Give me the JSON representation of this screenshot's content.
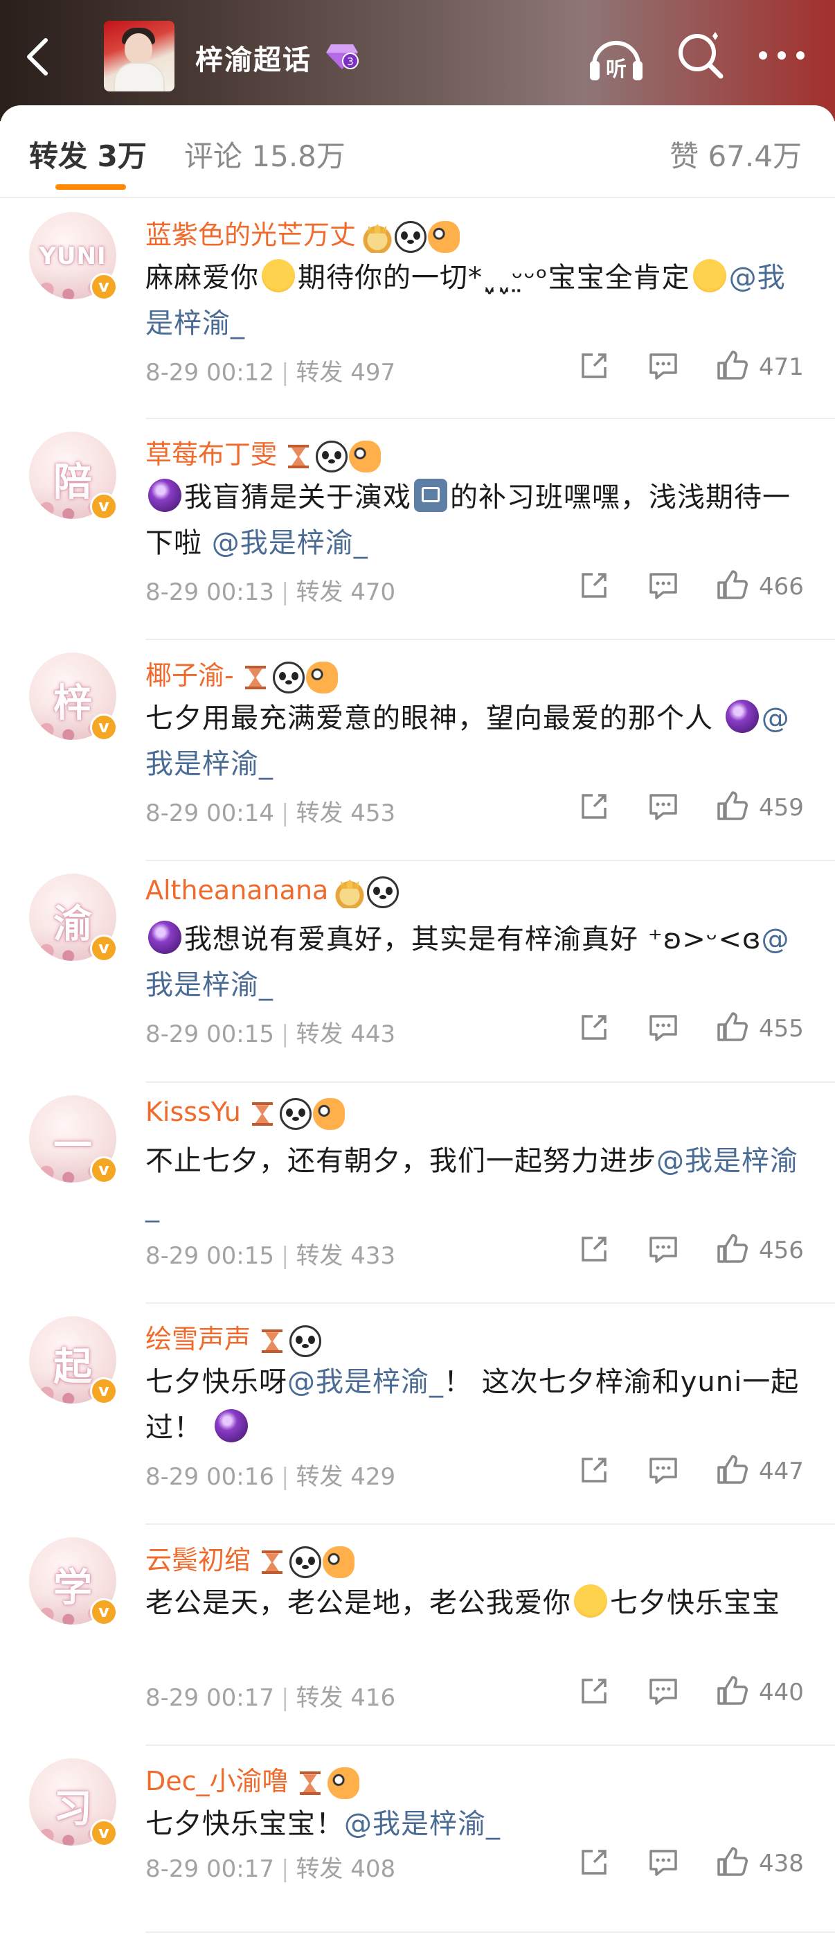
{
  "header": {
    "title": "梓渝超话",
    "icons": [
      "back-arrow-icon",
      "cover-photo",
      "diamond-level-icon",
      "listen-icon",
      "search-icon",
      "more-icon"
    ],
    "listen_label": "听",
    "gem_level": "3",
    "gradient_colors": [
      "#2a1f1b",
      "#6d5b57",
      "#a2302d"
    ]
  },
  "tabs": {
    "repost": {
      "label": "转发",
      "count": "3万"
    },
    "comment": {
      "label": "评论",
      "count": "15.8万"
    },
    "likes": {
      "label": "赞",
      "count": "67.4万"
    },
    "active": "repost",
    "accent": "#ff8a00"
  },
  "colors": {
    "username": "#f06a2b",
    "mention": "#4a6b94",
    "meta": "#a3a3a3"
  },
  "list": [
    {
      "avatar": "YUNI",
      "name": "蓝紫色的光芒万丈",
      "badges": [
        "crown",
        "panda",
        "fish"
      ],
      "content": [
        "麻麻爱你",
        {
          "emoji": "kiss"
        },
        "期待你的一切*ˬ̤ˬ̤ᵕ̤ᵕᵒ宝宝全肯定",
        {
          "emoji": "grin"
        },
        {
          "mention": "@我是梓渝_"
        }
      ],
      "time": "8-29 00:12",
      "repost_label": "转发",
      "repost_count": "497",
      "likes": "471"
    },
    {
      "avatar": "陪",
      "name": "草莓布丁雯",
      "badges": [
        "hourglass",
        "panda",
        "fish"
      ],
      "content": [
        {
          "emoji": "ball"
        },
        "我盲猜是关于演戏",
        {
          "emoji": "film"
        },
        "的补习班嘿嘿，浅浅期待一下啦 ",
        {
          "mention": "@我是梓渝_"
        }
      ],
      "time": "8-29 00:13",
      "repost_label": "转发",
      "repost_count": "470",
      "likes": "466"
    },
    {
      "avatar": "梓",
      "name": "椰子渝-",
      "badges": [
        "hourglass",
        "panda",
        "fish"
      ],
      "content": [
        "七夕用最充满爱意的眼神，望向最爱的那个人 ",
        {
          "emoji": "ball"
        },
        {
          "mention": "@我是梓渝_"
        }
      ],
      "time": "8-29 00:14",
      "repost_label": "转发",
      "repost_count": "453",
      "likes": "459"
    },
    {
      "avatar": "渝",
      "name": "Altheananana",
      "badges": [
        "crown",
        "panda"
      ],
      "content": [
        {
          "emoji": "ball"
        },
        "我想说有爱真好，其实是有梓渝真好 ⁺ʚ>ᵕ<ɞ",
        {
          "mention": "@我是梓渝_"
        }
      ],
      "time": "8-29 00:15",
      "repost_label": "转发",
      "repost_count": "443",
      "likes": "455"
    },
    {
      "avatar": "一",
      "name": "KisssYu",
      "badges": [
        "hourglass",
        "panda",
        "fish"
      ],
      "content": [
        "不止七夕，还有朝夕，我们一起努力进步",
        {
          "mention": "@我是梓渝_"
        }
      ],
      "time": "8-29 00:15",
      "repost_label": "转发",
      "repost_count": "433",
      "likes": "456"
    },
    {
      "avatar": "起",
      "name": "绘雪声声",
      "badges": [
        "hourglass",
        "panda"
      ],
      "content": [
        "七夕快乐呀",
        {
          "mention": "@我是梓渝_"
        },
        "！ 这次七夕梓渝和yuni一起过！ ",
        {
          "emoji": "ball"
        }
      ],
      "time": "8-29 00:16",
      "repost_label": "转发",
      "repost_count": "429",
      "likes": "447"
    },
    {
      "avatar": "学",
      "name": "云鬓初绾",
      "badges": [
        "hourglass",
        "panda",
        "fish"
      ],
      "content": [
        "老公是天，老公是地，老公我爱你",
        {
          "emoji": "love"
        },
        "七夕快乐宝宝"
      ],
      "time": "8-29 00:17",
      "repost_label": "转发",
      "repost_count": "416",
      "likes": "440"
    },
    {
      "avatar": "习",
      "name": "Dec_小渝噜",
      "badges": [
        "hourglass",
        "fish"
      ],
      "content": [
        "七夕快乐宝宝！",
        {
          "mention": "@我是梓渝_"
        }
      ],
      "time": "8-29 00:17",
      "repost_label": "转发",
      "repost_count": "408",
      "likes": "438"
    }
  ]
}
